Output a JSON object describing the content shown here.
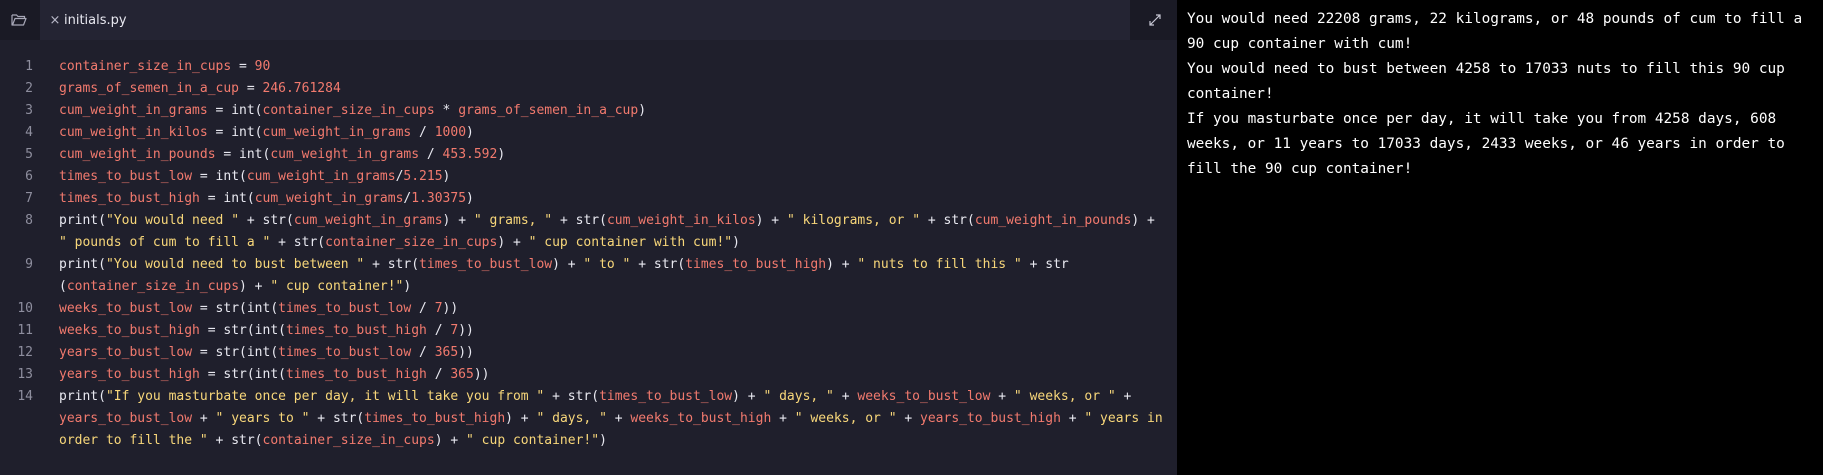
{
  "tab": {
    "filename": "initials.py",
    "close_glyph": "×"
  },
  "code": {
    "line_numbers": [
      "1",
      "2",
      "3",
      "4",
      "5",
      "6",
      "7",
      "8",
      "9",
      "10",
      "11",
      "12",
      "13",
      "14"
    ],
    "lines": [
      [
        {
          "t": "container_size_in_cups",
          "k": "v"
        },
        {
          "t": " = ",
          "k": "p"
        },
        {
          "t": "90",
          "k": "n"
        }
      ],
      [
        {
          "t": "grams_of_semen_in_a_cup",
          "k": "v"
        },
        {
          "t": " = ",
          "k": "p"
        },
        {
          "t": "246.761284",
          "k": "n"
        }
      ],
      [
        {
          "t": "cum_weight_in_grams",
          "k": "v"
        },
        {
          "t": " = int(",
          "k": "p"
        },
        {
          "t": "container_size_in_cups",
          "k": "v"
        },
        {
          "t": " * ",
          "k": "p"
        },
        {
          "t": "grams_of_semen_in_a_cup",
          "k": "v"
        },
        {
          "t": ")",
          "k": "p"
        }
      ],
      [
        {
          "t": "cum_weight_in_kilos",
          "k": "v"
        },
        {
          "t": " = int(",
          "k": "p"
        },
        {
          "t": "cum_weight_in_grams",
          "k": "v"
        },
        {
          "t": " / ",
          "k": "p"
        },
        {
          "t": "1000",
          "k": "n"
        },
        {
          "t": ")",
          "k": "p"
        }
      ],
      [
        {
          "t": "cum_weight_in_pounds",
          "k": "v"
        },
        {
          "t": " = int(",
          "k": "p"
        },
        {
          "t": "cum_weight_in_grams",
          "k": "v"
        },
        {
          "t": " / ",
          "k": "p"
        },
        {
          "t": "453.592",
          "k": "n"
        },
        {
          "t": ")",
          "k": "p"
        }
      ],
      [
        {
          "t": "times_to_bust_low",
          "k": "v"
        },
        {
          "t": " = int(",
          "k": "p"
        },
        {
          "t": "cum_weight_in_grams",
          "k": "v"
        },
        {
          "t": "/",
          "k": "p"
        },
        {
          "t": "5.215",
          "k": "n"
        },
        {
          "t": ")",
          "k": "p"
        }
      ],
      [
        {
          "t": "times_to_bust_high",
          "k": "v"
        },
        {
          "t": " = int(",
          "k": "p"
        },
        {
          "t": "cum_weight_in_grams",
          "k": "v"
        },
        {
          "t": "/",
          "k": "p"
        },
        {
          "t": "1.30375",
          "k": "n"
        },
        {
          "t": ")",
          "k": "p"
        }
      ],
      [
        {
          "t": "print(",
          "k": "p"
        },
        {
          "t": "\"You would need \"",
          "k": "s"
        },
        {
          "t": " + str(",
          "k": "p"
        },
        {
          "t": "cum_weight_in_grams",
          "k": "v"
        },
        {
          "t": ") + ",
          "k": "p"
        },
        {
          "t": "\" grams, \"",
          "k": "s"
        },
        {
          "t": " + str(",
          "k": "p"
        },
        {
          "t": "cum_weight_in_kilos",
          "k": "v"
        },
        {
          "t": ") + ",
          "k": "p"
        },
        {
          "t": "\" kilograms, or \"",
          "k": "s"
        },
        {
          "t": " + str(",
          "k": "p"
        },
        {
          "t": "cum_weight_in_pounds",
          "k": "v"
        },
        {
          "t": ") + ",
          "k": "p"
        },
        {
          "t": "\" pounds of cum to fill a \"",
          "k": "s"
        },
        {
          "t": " + str(",
          "k": "p"
        },
        {
          "t": "container_size_in_cups",
          "k": "v"
        },
        {
          "t": ") + ",
          "k": "p"
        },
        {
          "t": "\" cup container with cum!\"",
          "k": "s"
        },
        {
          "t": ")",
          "k": "p"
        }
      ],
      [
        {
          "t": "print(",
          "k": "p"
        },
        {
          "t": "\"You would need to bust between \"",
          "k": "s"
        },
        {
          "t": " + str(",
          "k": "p"
        },
        {
          "t": "times_to_bust_low",
          "k": "v"
        },
        {
          "t": ") + ",
          "k": "p"
        },
        {
          "t": "\" to \"",
          "k": "s"
        },
        {
          "t": " + str(",
          "k": "p"
        },
        {
          "t": "times_to_bust_high",
          "k": "v"
        },
        {
          "t": ") + ",
          "k": "p"
        },
        {
          "t": "\" nuts to fill this \"",
          "k": "s"
        },
        {
          "t": " + str (",
          "k": "p"
        },
        {
          "t": "container_size_in_cups",
          "k": "v"
        },
        {
          "t": ") + ",
          "k": "p"
        },
        {
          "t": "\" cup container!\"",
          "k": "s"
        },
        {
          "t": ")",
          "k": "p"
        }
      ],
      [
        {
          "t": "weeks_to_bust_low",
          "k": "v"
        },
        {
          "t": " = str(int(",
          "k": "p"
        },
        {
          "t": "times_to_bust_low",
          "k": "v"
        },
        {
          "t": " / ",
          "k": "p"
        },
        {
          "t": "7",
          "k": "n"
        },
        {
          "t": "))",
          "k": "p"
        }
      ],
      [
        {
          "t": "weeks_to_bust_high",
          "k": "v"
        },
        {
          "t": " = str(int(",
          "k": "p"
        },
        {
          "t": "times_to_bust_high",
          "k": "v"
        },
        {
          "t": " / ",
          "k": "p"
        },
        {
          "t": "7",
          "k": "n"
        },
        {
          "t": "))",
          "k": "p"
        }
      ],
      [
        {
          "t": "years_to_bust_low",
          "k": "v"
        },
        {
          "t": " = str(int(",
          "k": "p"
        },
        {
          "t": "times_to_bust_low",
          "k": "v"
        },
        {
          "t": " / ",
          "k": "p"
        },
        {
          "t": "365",
          "k": "n"
        },
        {
          "t": "))",
          "k": "p"
        }
      ],
      [
        {
          "t": "years_to_bust_high",
          "k": "v"
        },
        {
          "t": " = str(int(",
          "k": "p"
        },
        {
          "t": "times_to_bust_high",
          "k": "v"
        },
        {
          "t": " / ",
          "k": "p"
        },
        {
          "t": "365",
          "k": "n"
        },
        {
          "t": "))",
          "k": "p"
        }
      ],
      [
        {
          "t": "print(",
          "k": "p"
        },
        {
          "t": "\"If you masturbate once per day, it will take you from \"",
          "k": "s"
        },
        {
          "t": " + str(",
          "k": "p"
        },
        {
          "t": "times_to_bust_low",
          "k": "v"
        },
        {
          "t": ") + ",
          "k": "p"
        },
        {
          "t": "\" days, \"",
          "k": "s"
        },
        {
          "t": " + ",
          "k": "p"
        },
        {
          "t": "weeks_to_bust_low",
          "k": "v"
        },
        {
          "t": " + ",
          "k": "p"
        },
        {
          "t": "\" weeks, or \"",
          "k": "s"
        },
        {
          "t": " + ",
          "k": "p"
        },
        {
          "t": "years_to_bust_low",
          "k": "v"
        },
        {
          "t": " + ",
          "k": "p"
        },
        {
          "t": "\" years to \"",
          "k": "s"
        },
        {
          "t": " + str(",
          "k": "p"
        },
        {
          "t": "times_to_bust_high",
          "k": "v"
        },
        {
          "t": ") + ",
          "k": "p"
        },
        {
          "t": "\" days, \"",
          "k": "s"
        },
        {
          "t": " + ",
          "k": "p"
        },
        {
          "t": "weeks_to_bust_high",
          "k": "v"
        },
        {
          "t": " + ",
          "k": "p"
        },
        {
          "t": "\" weeks, or \"",
          "k": "s"
        },
        {
          "t": " + ",
          "k": "p"
        },
        {
          "t": "years_to_bust_high",
          "k": "v"
        },
        {
          "t": " + ",
          "k": "p"
        },
        {
          "t": "\" years in order to fill the \"",
          "k": "s"
        },
        {
          "t": " + str(",
          "k": "p"
        },
        {
          "t": "container_size_in_cups",
          "k": "v"
        },
        {
          "t": ") + ",
          "k": "p"
        },
        {
          "t": "\" cup container!\"",
          "k": "s"
        },
        {
          "t": ")",
          "k": "p"
        }
      ]
    ]
  },
  "output": {
    "lines": [
      "You would need 22208 grams, 22 kilograms, or 48 pounds of cum to fill a 90 cup container with cum!",
      "You would need to bust between 4258 to 17033 nuts to fill this 90 cup container!",
      "If you masturbate once per day, it will take you from 4258 days, 608 weeks, or 11 years to 17033 days, 2433 weeks, or 46 years in order to fill the 90 cup container!"
    ]
  },
  "icons": {
    "files": "folder-open-icon",
    "close": "close-icon",
    "expand": "expand-icon"
  },
  "colors": {
    "editor_bg": "#1f1f2c",
    "output_bg": "#000000",
    "variable": "#f27a6e",
    "number": "#f27a6e",
    "string": "#f8d77a",
    "plain": "#e9e9f1"
  }
}
